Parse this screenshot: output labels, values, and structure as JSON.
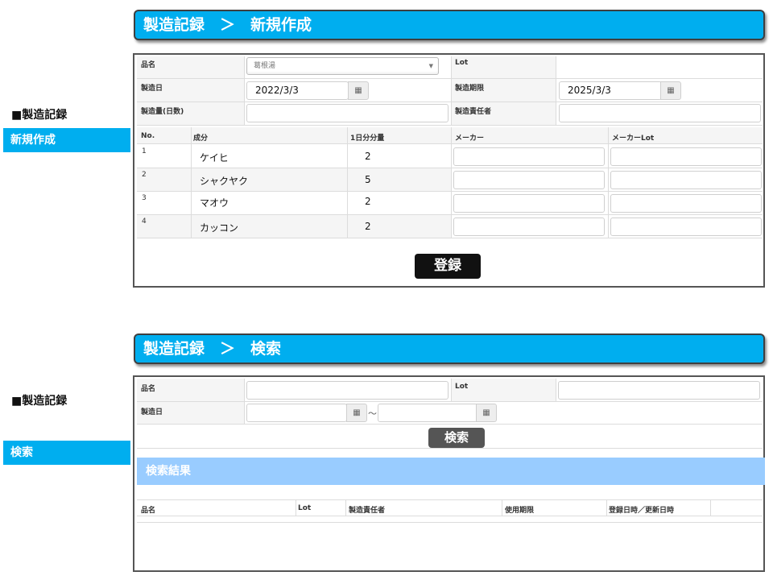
{
  "create_screen": {
    "banner": "製造記録　＞　新規作成",
    "side_heading": "■製造記録",
    "side_nav": "新規作成",
    "form": {
      "product_label": "品名",
      "product_value": "葛根湯",
      "lot_label": "Lot",
      "mfg_date_label": "製造日",
      "mfg_date_value": "2022/3/3",
      "expiry_label": "製造期限",
      "expiry_value": "2025/3/3",
      "quantity_label": "製造量(日数)",
      "responsible_label": "製造責任者"
    },
    "table": {
      "headers": [
        "No.",
        "成分",
        "1日分分量",
        "メーカー",
        "メーカーLot"
      ],
      "rows": [
        {
          "no": "1",
          "ingredient": "ケイヒ",
          "amount": "2"
        },
        {
          "no": "2",
          "ingredient": "シャクヤク",
          "amount": "5"
        },
        {
          "no": "3",
          "ingredient": "マオウ",
          "amount": "2"
        },
        {
          "no": "4",
          "ingredient": "カッコン",
          "amount": "2"
        }
      ]
    },
    "submit_label": "登録"
  },
  "search_screen": {
    "banner": "製造記録　＞　検索",
    "side_heading": "■製造記録",
    "side_nav": "検索",
    "form": {
      "product_label": "品名",
      "lot_label": "Lot",
      "mfg_date_label": "製造日",
      "range_separator": "～"
    },
    "search_label": "検索",
    "results_title": "検索結果",
    "results_headers": [
      "品名",
      "Lot",
      "製造責任者",
      "使用期限",
      "登録日時／更新日時"
    ]
  },
  "icons": {
    "calendar": "calendar-icon",
    "dropdown": "chevron-down-icon"
  },
  "colors": {
    "banner": "#00aeef",
    "nav": "#00aeef",
    "result_bar": "#99ccff",
    "submit": "#111111",
    "search": "#555555"
  }
}
